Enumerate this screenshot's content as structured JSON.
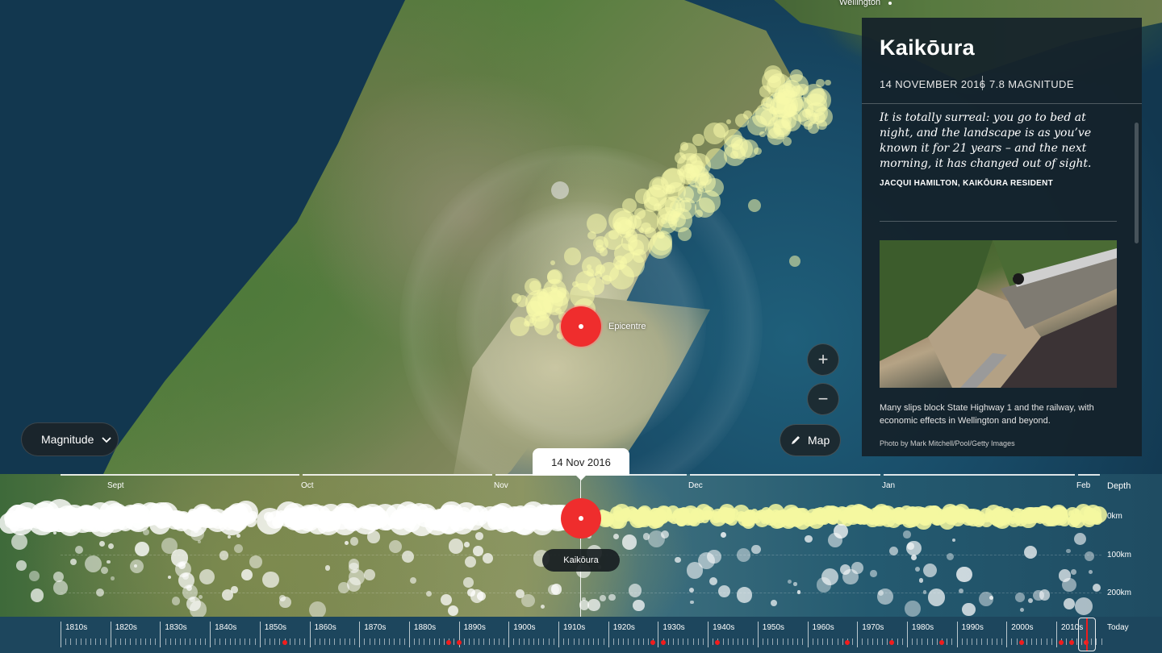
{
  "map": {
    "wellington_label": "Wellington",
    "epicentre_label": "Epicentre",
    "map_button_label": "Map",
    "zoom_in_glyph": "+",
    "zoom_out_glyph": "−"
  },
  "filter": {
    "label": "Magnitude"
  },
  "panel": {
    "title": "Kaikōura",
    "date": "14 NOVEMBER 2016",
    "magnitude": "7.8 MAGNITUDE",
    "quote": "It is totally surreal: you go to bed at night, and the landscape is as you’ve known it for 21 years – and the next morning, it has changed out of sight.",
    "attribution": "JACQUI HAMILTON, KAIKŌURA RESIDENT",
    "caption": "Many slips block State Highway 1 and the railway, with economic effects in Wellington and beyond.",
    "credit": "Photo by Mark Mitchell/Pool/Getty Images"
  },
  "timeline": {
    "current_date": "14 Nov 2016",
    "quake_label": "Kaikōura",
    "depth_title": "Depth",
    "depth_labels": [
      "0km",
      "100km",
      "200km"
    ],
    "months": [
      "Sept",
      "Oct",
      "Nov",
      "Dec",
      "Jan",
      "Feb"
    ]
  },
  "decades": {
    "labels": [
      "1810s",
      "1820s",
      "1830s",
      "1840s",
      "1850s",
      "1860s",
      "1870s",
      "1880s",
      "1890s",
      "1900s",
      "1910s",
      "1920s",
      "1930s",
      "1940s",
      "1950s",
      "1960s",
      "1970s",
      "1980s",
      "1990s",
      "2000s",
      "2010s"
    ],
    "today_label": "Today",
    "quake_years": [
      1855,
      1888,
      1890,
      1929,
      1931,
      1942,
      1968,
      1977,
      1987,
      2003,
      2011,
      2013,
      2016
    ]
  },
  "colors": {
    "accent_red": "#ef2d2d",
    "aftershock_yellow": "#f8faaa",
    "panel_bg": "#14212a"
  },
  "icons": {
    "dropdown": "chevron-down-icon",
    "map": "pencil-icon",
    "zoom_in": "plus-icon",
    "zoom_out": "minus-icon"
  }
}
